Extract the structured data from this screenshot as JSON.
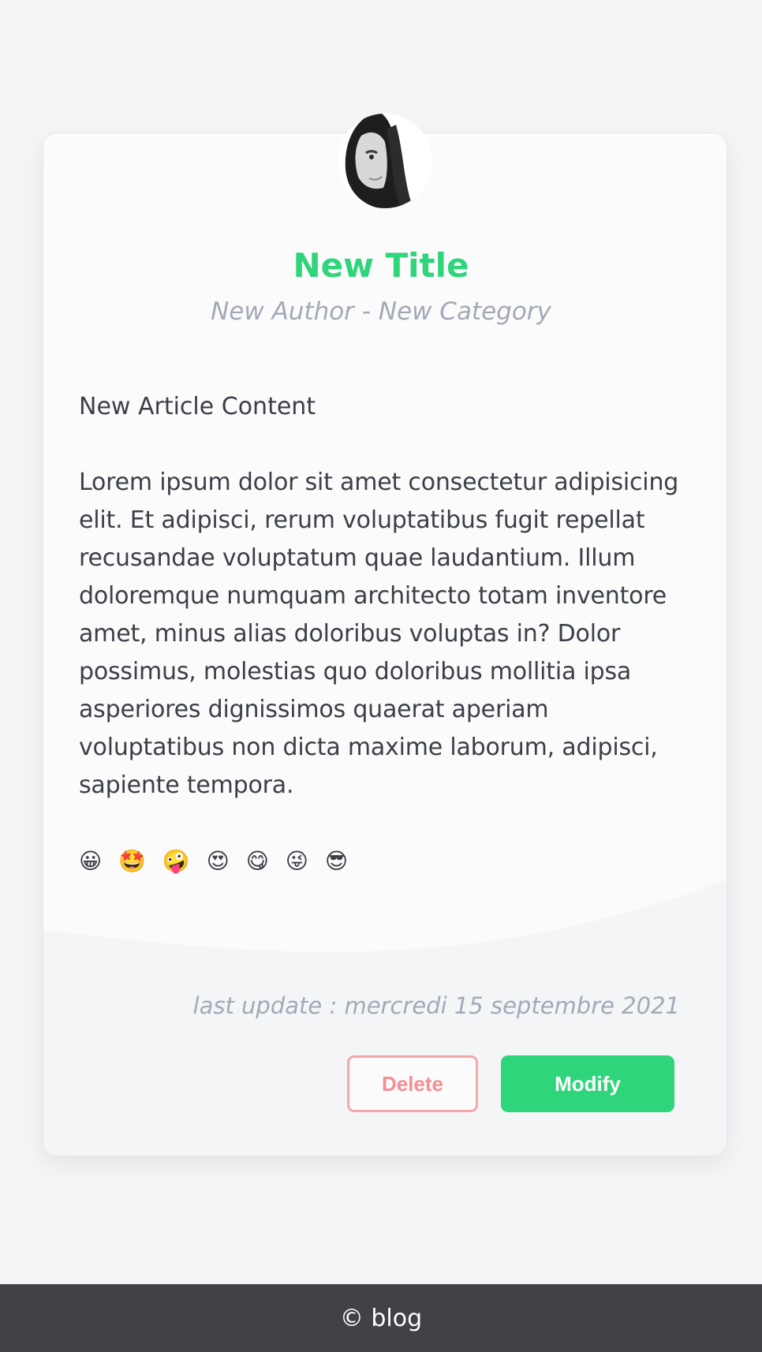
{
  "article": {
    "title": "New Title",
    "subtitle": "New Author - New Category",
    "heading": "New Article Content",
    "body": "Lorem ipsum dolor sit amet consectetur adipisicing elit. Et adipisci, rerum voluptatibus fugit repellat recusandae voluptatum quae laudantium. Illum doloremque numquam architecto totam inventore amet, minus alias doloribus voluptas in? Dolor possimus, molestias quo doloribus mollitia ipsa asperiores dignissimos quaerat aperiam voluptatibus non dicta maxime laborum, adipisci, sapiente tempora.",
    "emojis": "😀 🤩 🤪 😍 😋 😜 😎",
    "last_update": "last update : mercredi 15 septembre 2021",
    "avatar_icon": "author-avatar-photo"
  },
  "actions": {
    "delete_label": "Delete",
    "modify_label": "Modify"
  },
  "footer": {
    "text": "© blog"
  },
  "colors": {
    "accent": "#2fd57a",
    "danger": "#f48f93",
    "muted": "#a3a9b6",
    "footer_bg": "#404247",
    "page_bg": "#f4f5f7"
  }
}
